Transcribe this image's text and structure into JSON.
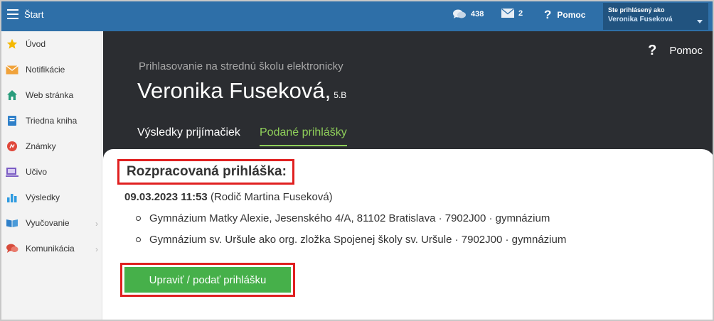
{
  "topbar": {
    "menu_label": "Štart",
    "messages_count": "438",
    "mail_count": "2",
    "help_label": "Pomoc",
    "user_caption": "Ste prihlásený ako",
    "user_name": "Veronika Fuseková"
  },
  "sidebar": {
    "items": [
      {
        "label": "Úvod",
        "icon": "star-icon"
      },
      {
        "label": "Notifikácie",
        "icon": "envelope-icon"
      },
      {
        "label": "Web stránka",
        "icon": "home-icon"
      },
      {
        "label": "Triedna kniha",
        "icon": "book-icon"
      },
      {
        "label": "Známky",
        "icon": "grades-icon"
      },
      {
        "label": "Učivo",
        "icon": "curriculum-icon"
      },
      {
        "label": "Výsledky",
        "icon": "bar-chart-icon"
      },
      {
        "label": "Vyučovanie",
        "icon": "open-book-icon"
      },
      {
        "label": "Komunikácia",
        "icon": "chat-icon"
      }
    ]
  },
  "header": {
    "help_label": "Pomoc",
    "subtitle": "Prihlasovanie na strednú školu elektronicky",
    "student_name": "Veronika Fuseková,",
    "student_class": "5.B",
    "tabs": [
      {
        "label": "Výsledky prijímačiek",
        "active": false
      },
      {
        "label": "Podané prihlášky",
        "active": true
      }
    ]
  },
  "application": {
    "title": "Rozpracovaná prihláška:",
    "datetime": "09.03.2023 11:53",
    "author": "(Rodič Martina Fuseková)",
    "schools": [
      "Gymnázium Matky Alexie, Jesenského 4/A, 81102 Bratislava · 7902J00 · gymnázium",
      "Gymnázium sv. Uršule ako org. zložka Spojenej školy sv. Uršule · 7902J00 · gymnázium"
    ],
    "edit_button": "Upraviť / podať prihlášku"
  },
  "colors": {
    "topbar": "#2e6fa8",
    "header_dark": "#2b2d31",
    "active_tab": "#8fcf5a",
    "button": "#46b04a",
    "highlight": "#e02020"
  }
}
